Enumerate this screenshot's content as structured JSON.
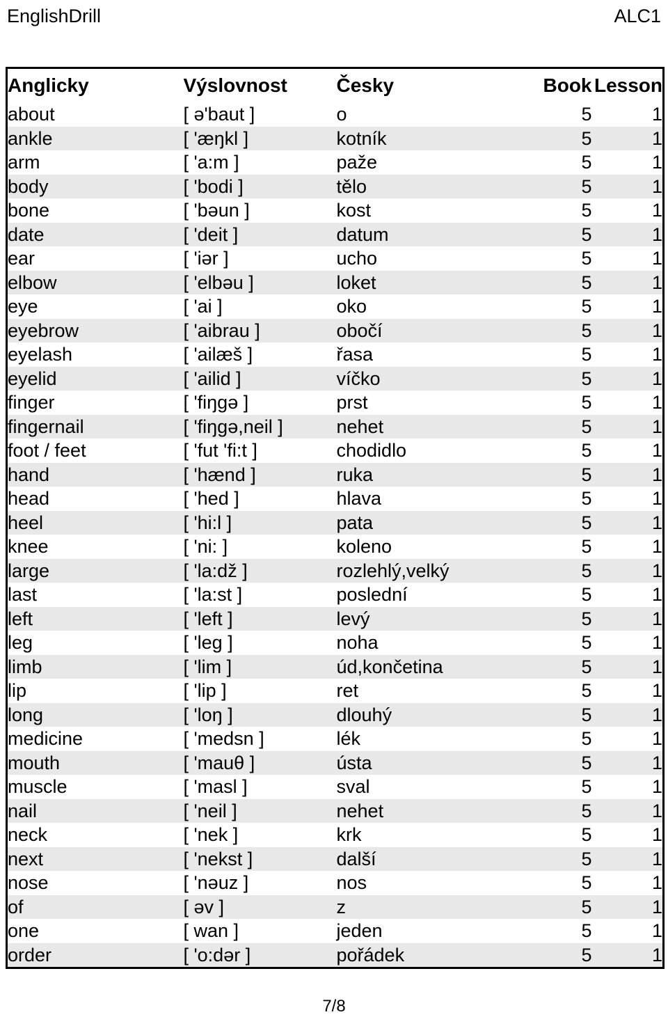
{
  "header": {
    "brand": "EnglishDrill",
    "code": "ALC1"
  },
  "table": {
    "columns": {
      "english": "Anglicky",
      "pronunciation": "Výslovnost",
      "czech": "Česky",
      "book": "Book",
      "lesson": "Lesson"
    },
    "rows": [
      {
        "english": "about",
        "pronunciation": "[ ə'baut ]",
        "czech": "o",
        "book": "5",
        "lesson": "1"
      },
      {
        "english": "ankle",
        "pronunciation": "[ 'æŋkl ]",
        "czech": "kotník",
        "book": "5",
        "lesson": "1"
      },
      {
        "english": "arm",
        "pronunciation": "[ 'a:m ]",
        "czech": "paže",
        "book": "5",
        "lesson": "1"
      },
      {
        "english": "body",
        "pronunciation": "[ 'bodi ]",
        "czech": "tělo",
        "book": "5",
        "lesson": "1"
      },
      {
        "english": "bone",
        "pronunciation": "[ 'bəun ]",
        "czech": "kost",
        "book": "5",
        "lesson": "1"
      },
      {
        "english": "date",
        "pronunciation": "[ 'deit ]",
        "czech": "datum",
        "book": "5",
        "lesson": "1"
      },
      {
        "english": "ear",
        "pronunciation": "[ 'iər ]",
        "czech": "ucho",
        "book": "5",
        "lesson": "1"
      },
      {
        "english": "elbow",
        "pronunciation": "[ 'elbəu ]",
        "czech": "loket",
        "book": "5",
        "lesson": "1"
      },
      {
        "english": "eye",
        "pronunciation": "[ 'ai ]",
        "czech": "oko",
        "book": "5",
        "lesson": "1"
      },
      {
        "english": "eyebrow",
        "pronunciation": "[ 'aibrau ]",
        "czech": "obočí",
        "book": "5",
        "lesson": "1"
      },
      {
        "english": "eyelash",
        "pronunciation": "[ 'ailæš ]",
        "czech": "řasa",
        "book": "5",
        "lesson": "1"
      },
      {
        "english": "eyelid",
        "pronunciation": "[ 'ailid ]",
        "czech": "víčko",
        "book": "5",
        "lesson": "1"
      },
      {
        "english": "finger",
        "pronunciation": "[ 'fiŋgə ]",
        "czech": "prst",
        "book": "5",
        "lesson": "1"
      },
      {
        "english": "fingernail",
        "pronunciation": "[ 'fiŋgə,neil ]",
        "czech": "nehet",
        "book": "5",
        "lesson": "1"
      },
      {
        "english": "foot / feet",
        "pronunciation": "[ 'fut 'fi:t ]",
        "czech": "chodidlo",
        "book": "5",
        "lesson": "1"
      },
      {
        "english": "hand",
        "pronunciation": "[ 'hænd ]",
        "czech": "ruka",
        "book": "5",
        "lesson": "1"
      },
      {
        "english": "head",
        "pronunciation": "[ 'hed ]",
        "czech": "hlava",
        "book": "5",
        "lesson": "1"
      },
      {
        "english": "heel",
        "pronunciation": "[ 'hi:l ]",
        "czech": "pata",
        "book": "5",
        "lesson": "1"
      },
      {
        "english": "knee",
        "pronunciation": "[ 'ni: ]",
        "czech": "koleno",
        "book": "5",
        "lesson": "1"
      },
      {
        "english": "large",
        "pronunciation": "[ 'la:dž ]",
        "czech": "rozlehlý,velký",
        "book": "5",
        "lesson": "1"
      },
      {
        "english": "last",
        "pronunciation": "[ 'la:st ]",
        "czech": "poslední",
        "book": "5",
        "lesson": "1"
      },
      {
        "english": "left",
        "pronunciation": "[ 'left ]",
        "czech": "levý",
        "book": "5",
        "lesson": "1"
      },
      {
        "english": "leg",
        "pronunciation": "[ 'leg ]",
        "czech": "noha",
        "book": "5",
        "lesson": "1"
      },
      {
        "english": "limb",
        "pronunciation": "[ 'lim ]",
        "czech": "úd,končetina",
        "book": "5",
        "lesson": "1"
      },
      {
        "english": "lip",
        "pronunciation": "[ 'lip ]",
        "czech": "ret",
        "book": "5",
        "lesson": "1"
      },
      {
        "english": "long",
        "pronunciation": "[ 'loŋ ]",
        "czech": "dlouhý",
        "book": "5",
        "lesson": "1"
      },
      {
        "english": "medicine",
        "pronunciation": "[ 'medsn ]",
        "czech": "lék",
        "book": "5",
        "lesson": "1"
      },
      {
        "english": "mouth",
        "pronunciation": "[ 'mauθ ]",
        "czech": "ústa",
        "book": "5",
        "lesson": "1"
      },
      {
        "english": "muscle",
        "pronunciation": "[ 'masl ]",
        "czech": "sval",
        "book": "5",
        "lesson": "1"
      },
      {
        "english": "nail",
        "pronunciation": "[ 'neil ]",
        "czech": "nehet",
        "book": "5",
        "lesson": "1"
      },
      {
        "english": "neck",
        "pronunciation": "[ 'nek ]",
        "czech": "krk",
        "book": "5",
        "lesson": "1"
      },
      {
        "english": "next",
        "pronunciation": "[ 'nekst ]",
        "czech": "další",
        "book": "5",
        "lesson": "1"
      },
      {
        "english": "nose",
        "pronunciation": "[ 'nəuz ]",
        "czech": "nos",
        "book": "5",
        "lesson": "1"
      },
      {
        "english": "of",
        "pronunciation": "[ əv ]",
        "czech": "z",
        "book": "5",
        "lesson": "1"
      },
      {
        "english": "one",
        "pronunciation": "[ wan ]",
        "czech": "jeden",
        "book": "5",
        "lesson": "1"
      },
      {
        "english": "order",
        "pronunciation": "[ 'o:dər ]",
        "czech": "pořádek",
        "book": "5",
        "lesson": "1"
      }
    ]
  },
  "footer": {
    "page_indicator": "7/8"
  }
}
